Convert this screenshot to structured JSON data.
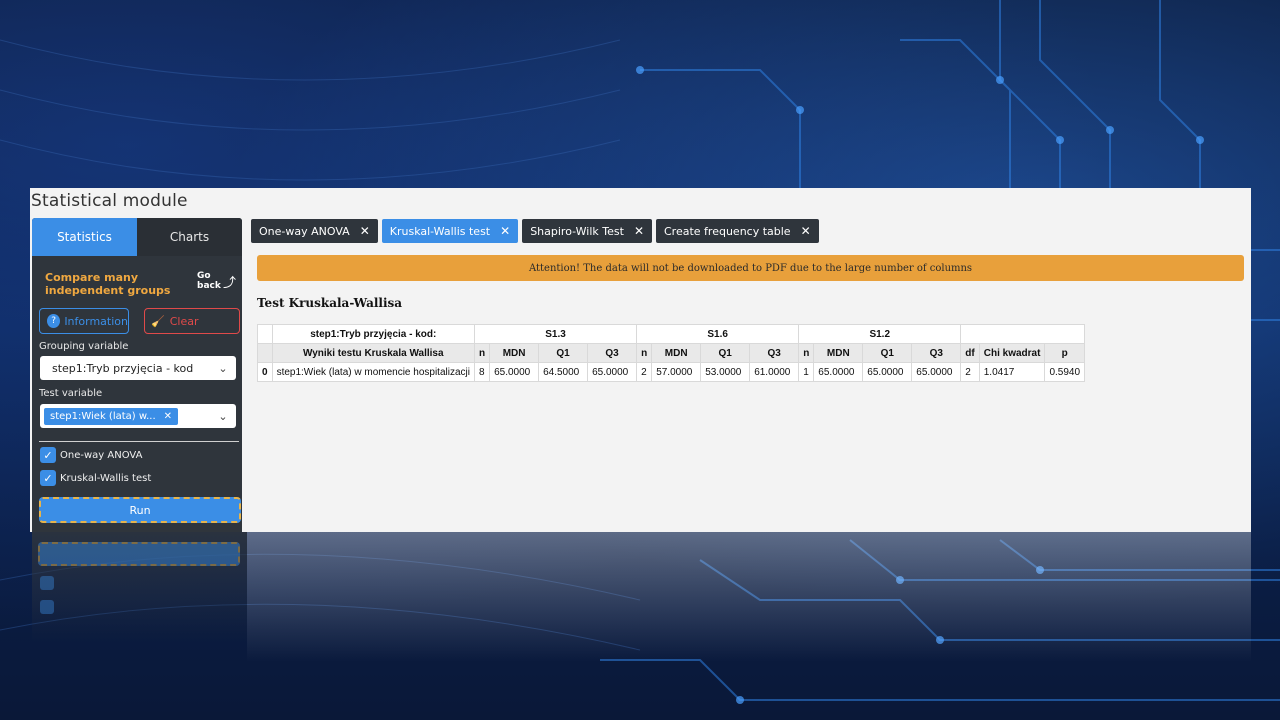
{
  "app": {
    "title": "Statistical module"
  },
  "sidebar": {
    "tabs": [
      {
        "label": "Statistics",
        "active": true
      },
      {
        "label": "Charts",
        "active": false
      }
    ],
    "section_title": "Compare many independent groups",
    "go_back": "Go back",
    "information_label": "Information",
    "clear_label": "Clear",
    "grouping_label": "Grouping variable",
    "grouping_value": "step1:Tryb przyjęcia - kod",
    "test_label": "Test variable",
    "test_chip": "step1:Wiek (lata) w...",
    "checks": [
      {
        "label": "One-way ANOVA",
        "checked": true
      },
      {
        "label": "Kruskal-Wallis test",
        "checked": true
      }
    ],
    "run_label": "Run"
  },
  "tabs": [
    {
      "label": "One-way ANOVA",
      "active": false
    },
    {
      "label": "Kruskal-Wallis test",
      "active": true
    },
    {
      "label": "Shapiro-Wilk Test",
      "active": false
    },
    {
      "label": "Create frequency table",
      "active": false
    }
  ],
  "alert": "Attention! The data will not be downloaded to PDF due to the large number of columns",
  "result": {
    "heading": "Test Kruskala-Wallisa",
    "group_header_label": "step1:Tryb przyjęcia - kod:",
    "groups": [
      "S1.3",
      "S1.6",
      "S1.2"
    ],
    "row_header_label": "Wyniki testu Kruskala Wallisa",
    "sub_columns": [
      "n",
      "MDN",
      "Q1",
      "Q3"
    ],
    "final_columns": [
      "df",
      "Chi kwadrat",
      "p"
    ],
    "row": {
      "index": "0",
      "label": "step1:Wiek (lata) w momencie hospitalizacji",
      "values": [
        "8",
        "65.0000",
        "64.5000",
        "65.0000",
        "2",
        "57.0000",
        "53.0000",
        "61.0000",
        "1",
        "65.0000",
        "65.0000",
        "65.0000",
        "2",
        "1.0417",
        "0.5940"
      ]
    }
  },
  "colors": {
    "accent": "#3b8ee6",
    "warning": "#e8a03b",
    "danger": "#e04a4a",
    "panel": "#2f353c"
  }
}
